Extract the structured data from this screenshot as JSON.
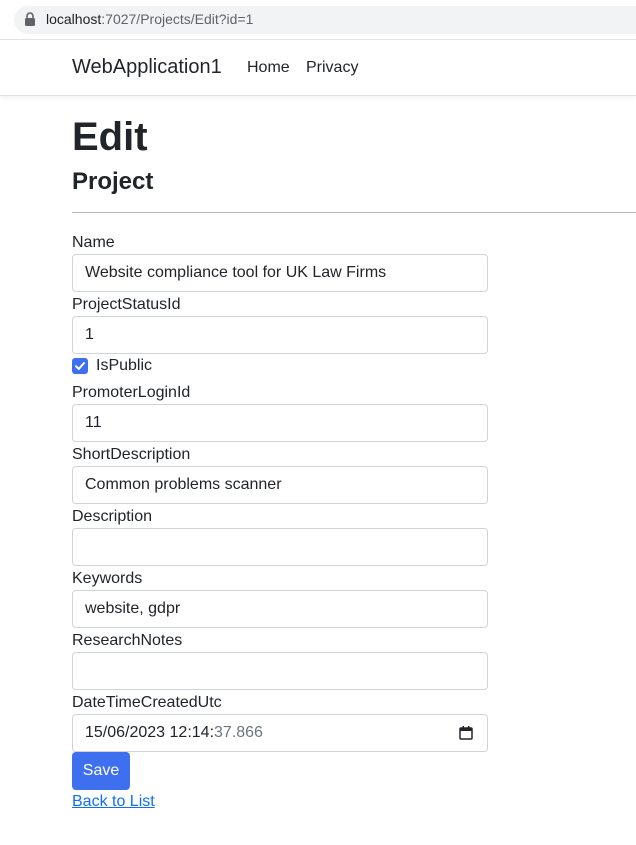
{
  "browser": {
    "url_host": "localhost",
    "url_path": ":7027/Projects/Edit?id=1"
  },
  "navbar": {
    "brand": "WebApplication1",
    "links": [
      "Home",
      "Privacy"
    ]
  },
  "page": {
    "title": "Edit",
    "subtitle": "Project"
  },
  "form": {
    "name": {
      "label": "Name",
      "value": "Website compliance tool for UK Law Firms"
    },
    "project_status_id": {
      "label": "ProjectStatusId",
      "value": "1"
    },
    "is_public": {
      "label": "IsPublic",
      "checked": true
    },
    "promoter_login_id": {
      "label": "PromoterLoginId",
      "value": "11"
    },
    "short_description": {
      "label": "ShortDescription",
      "value": "Common problems scanner"
    },
    "description": {
      "label": "Description",
      "value": ""
    },
    "keywords": {
      "label": "Keywords",
      "value": "website, gdpr"
    },
    "research_notes": {
      "label": "ResearchNotes",
      "value": ""
    },
    "date_time_created_utc": {
      "label": "DateTimeCreatedUtc",
      "value_main": "15/06/2023 12:14:",
      "value_seconds": "37.866"
    },
    "save_label": "Save",
    "back_link": "Back to List"
  },
  "colors": {
    "primary_button": "#3d6fef",
    "link": "#0d6efd",
    "border": "#ced4da"
  }
}
